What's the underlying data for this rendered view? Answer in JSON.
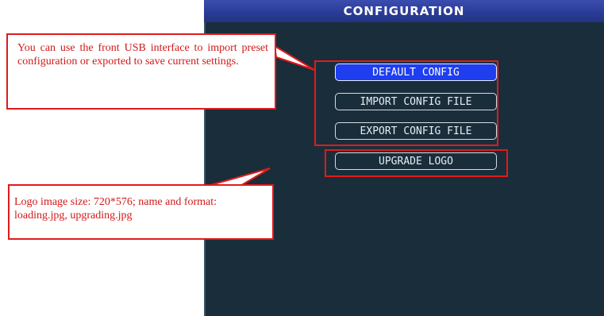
{
  "screen": {
    "title": "CONFIGURATION",
    "buttons": [
      {
        "label": "DEFAULT CONFIG",
        "selected": true
      },
      {
        "label": "IMPORT CONFIG FILE",
        "selected": false
      },
      {
        "label": "EXPORT CONFIG FILE",
        "selected": false
      },
      {
        "label": "UPGRADE LOGO",
        "selected": false
      }
    ]
  },
  "annotations": {
    "usb_note": "You can use the front USB interface to import preset configuration or exported to save current settings.",
    "logo_note": "Logo image size: 720*576; name and format: loading.jpg, upgrading.jpg"
  },
  "colors": {
    "screen_bg": "#1a2d3a",
    "title_bar": "#2b3c98",
    "selected_button": "#1e3ef0",
    "annotation_red": "#e01b1b"
  }
}
